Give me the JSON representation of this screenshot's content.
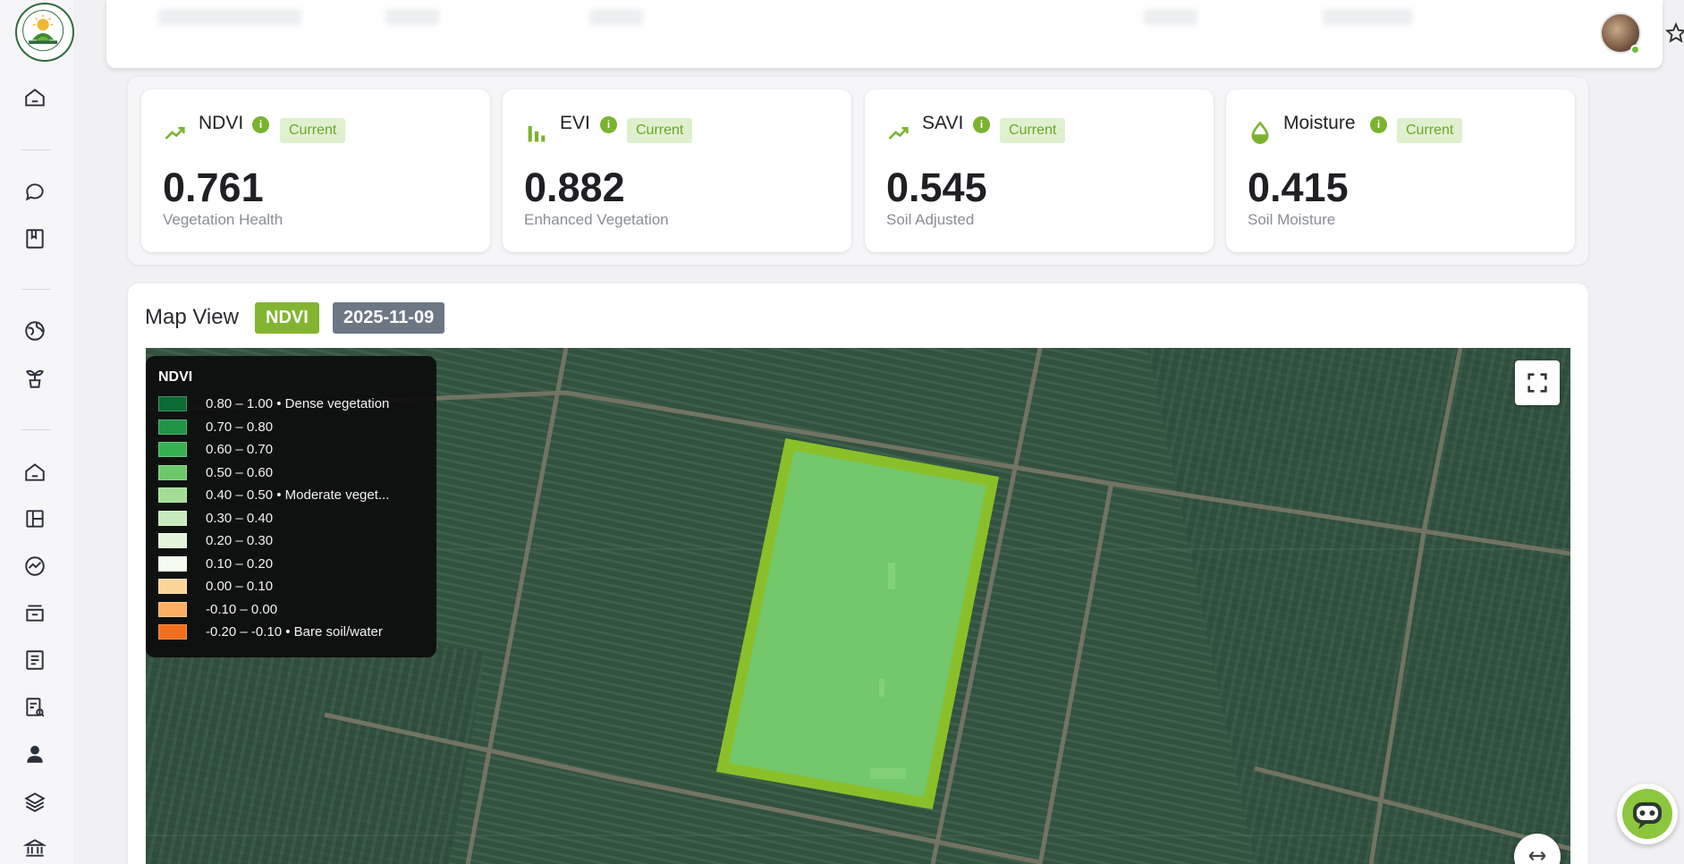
{
  "sidebar": {
    "icons": [
      "home-icon",
      "chat-bubble-icon",
      "book-icon",
      "globe-icon",
      "plant-icon",
      "home-outline-icon",
      "layout-icon",
      "analytics-icon",
      "archive-icon",
      "list-icon",
      "report-icon",
      "user-icon",
      "layers-icon",
      "bank-icon"
    ]
  },
  "header": {
    "star_icon": "star-icon",
    "avatar": "user-avatar"
  },
  "metrics": [
    {
      "icon": "trend-up-icon",
      "title": "NDVI",
      "badge": "Current",
      "value": "0.761",
      "subtitle": "Vegetation Health"
    },
    {
      "icon": "bar-chart-icon",
      "title": "EVI",
      "badge": "Current",
      "value": "0.882",
      "subtitle": "Enhanced Vegetation"
    },
    {
      "icon": "trend-up-icon",
      "title": "SAVI",
      "badge": "Current",
      "value": "0.545",
      "subtitle": "Soil Adjusted"
    },
    {
      "icon": "water-drop-icon",
      "title": "Moisture",
      "badge": "Current",
      "value": "0.415",
      "subtitle": "Soil Moisture"
    }
  ],
  "map": {
    "title": "Map View",
    "index_badge": "NDVI",
    "date_badge": "2025-11-09",
    "legend": {
      "title": "NDVI",
      "items": [
        {
          "color": "#0b6b32",
          "label": "0.80 – 1.00 • Dense vegetation"
        },
        {
          "color": "#1f9447",
          "label": "0.70 – 0.80"
        },
        {
          "color": "#37b052",
          "label": "0.60 – 0.70"
        },
        {
          "color": "#6cc86a",
          "label": "0.50 – 0.60"
        },
        {
          "color": "#a3dd95",
          "label": "0.40 – 0.50 • Moderate veget..."
        },
        {
          "color": "#c8ebbd",
          "label": "0.30 – 0.40"
        },
        {
          "color": "#e2f4dc",
          "label": "0.20 – 0.30"
        },
        {
          "color": "#f4fbf1",
          "label": "0.10 – 0.20"
        },
        {
          "color": "#fdd49a",
          "label": "0.00 – 0.10"
        },
        {
          "color": "#fdae61",
          "label": "-0.10 – 0.00"
        },
        {
          "color": "#f46d1c",
          "label": "-0.20 – -0.10 • Bare soil/water"
        }
      ]
    },
    "field_fill_color": "#72c86a",
    "field_border_color": "#8bbf2a"
  }
}
